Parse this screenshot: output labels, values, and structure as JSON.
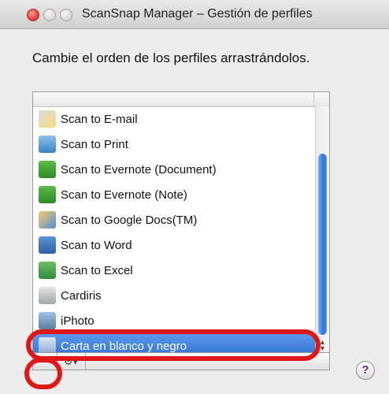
{
  "window": {
    "title": "ScanSnap Manager – Gestión de perfiles"
  },
  "instruction": "Cambie el orden de los perfiles arrastrándolos.",
  "profiles": [
    {
      "label": "Scan to E-mail",
      "icon": "email-icon"
    },
    {
      "label": "Scan to Print",
      "icon": "printer-icon"
    },
    {
      "label": "Scan to Evernote (Document)",
      "icon": "evernote-pdf-icon"
    },
    {
      "label": "Scan to Evernote (Note)",
      "icon": "evernote-jpg-icon"
    },
    {
      "label": "Scan to Google Docs(TM)",
      "icon": "google-docs-icon"
    },
    {
      "label": "Scan to Word",
      "icon": "word-icon"
    },
    {
      "label": "Scan to Excel",
      "icon": "excel-icon"
    },
    {
      "label": "Cardiris",
      "icon": "cardiris-icon"
    },
    {
      "label": "iPhoto",
      "icon": "iphoto-icon"
    },
    {
      "label": "Carta en blanco y negro",
      "icon": "profile-icon",
      "selected": true
    }
  ],
  "toolbar": {
    "remove_label": "−",
    "gear_label": "⚙▾"
  },
  "help": {
    "label": "?"
  },
  "annotations": {
    "highlight_color": "#e01717"
  }
}
